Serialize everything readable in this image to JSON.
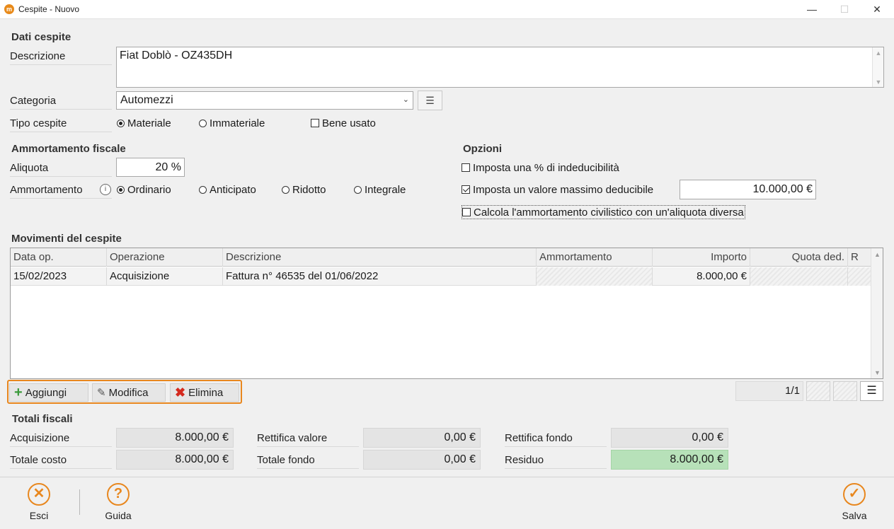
{
  "window": {
    "title": "Cespite - Nuovo",
    "icon_letter": "m"
  },
  "dati": {
    "section_title": "Dati cespite",
    "descrizione_label": "Descrizione",
    "descrizione_value": "Fiat Doblò - OZ435DH",
    "categoria_label": "Categoria",
    "categoria_value": "Automezzi",
    "tipo_label": "Tipo cespite",
    "tipo_options": [
      "Materiale",
      "Immateriale"
    ],
    "tipo_selected": "Materiale",
    "bene_usato_label": "Bene usato",
    "bene_usato_checked": false
  },
  "ammortamento": {
    "section_title": "Ammortamento fiscale",
    "aliquota_label": "Aliquota",
    "aliquota_value": "20 %",
    "tipo_label": "Ammortamento",
    "options": [
      "Ordinario",
      "Anticipato",
      "Ridotto",
      "Integrale"
    ],
    "selected": "Ordinario"
  },
  "opzioni": {
    "section_title": "Opzioni",
    "opt1_label": "Imposta una % di indeducibilità",
    "opt1_checked": false,
    "opt2_label": "Imposta un valore massimo deducibile",
    "opt2_checked": true,
    "opt2_value": "10.000,00 €",
    "opt3_label": "Calcola l'ammortamento civilistico con un'aliquota diversa",
    "opt3_checked": false
  },
  "movimenti": {
    "section_title": "Movimenti del cespite",
    "columns": [
      "Data op.",
      "Operazione",
      "Descrizione",
      "Ammortamento",
      "Importo",
      "Quota ded.",
      "R"
    ],
    "rows": [
      {
        "data": "15/02/2023",
        "operazione": "Acquisizione",
        "descrizione": "Fattura n° 46535 del 01/06/2022",
        "ammortamento": "",
        "importo": "8.000,00 €",
        "quota": "",
        "r": ""
      }
    ],
    "buttons": {
      "aggiungi": "Aggiungi",
      "modifica": "Modifica",
      "elimina": "Elimina"
    },
    "pager": "1/1"
  },
  "totali": {
    "section_title": "Totali fiscali",
    "acquisizione_label": "Acquisizione",
    "acquisizione_value": "8.000,00 €",
    "totale_costo_label": "Totale costo",
    "totale_costo_value": "8.000,00 €",
    "rettifica_valore_label": "Rettifica valore",
    "rettifica_valore_value": "0,00 €",
    "totale_fondo_label": "Totale fondo",
    "totale_fondo_value": "0,00 €",
    "rettifica_fondo_label": "Rettifica fondo",
    "rettifica_fondo_value": "0,00 €",
    "residuo_label": "Residuo",
    "residuo_value": "8.000,00 €"
  },
  "footer": {
    "esci": "Esci",
    "guida": "Guida",
    "salva": "Salva"
  },
  "colors": {
    "accent": "#e8871e",
    "residuo_bg": "#b7e1b9",
    "add_icon": "#3a9a3a",
    "delete_icon": "#d42a1e"
  }
}
